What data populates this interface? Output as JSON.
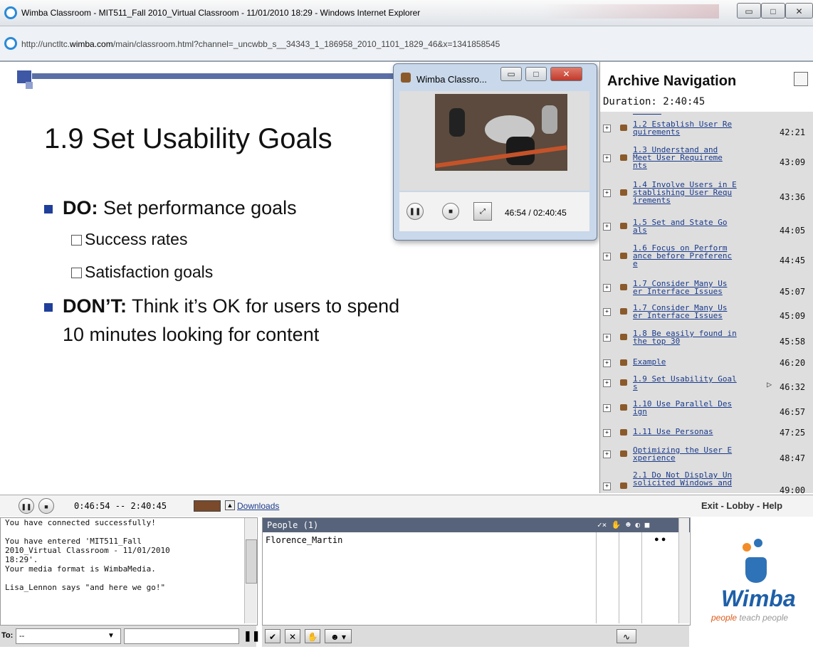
{
  "window": {
    "title": "Wimba Classroom - MIT511_Fall 2010_Virtual Classroom - 11/01/2010 18:29 - Windows Internet Explorer",
    "url_prefix": "http://unctltc.",
    "url_domain": "wimba.com",
    "url_suffix": "/main/classroom.html?channel=_uncwbb_s__34343_1_186958_2010_1101_1829_46&x=1341858545"
  },
  "slide": {
    "title": "1.9 Set Usability Goals",
    "do_label": "DO:",
    "do_text": " Set performance goals",
    "sub1": "Success rates",
    "sub2": "Satisfaction goals",
    "dont_label": "DON’T:",
    "dont_text": " Think it’s OK for users to spend",
    "dont_text2": "10 minutes looking for content"
  },
  "popup": {
    "title": "Wimba Classro...",
    "time": "46:54 / 02:40:45"
  },
  "nav": {
    "title": "Archive Navigation",
    "duration": "Duration: 2:40:45",
    "items": [
      {
        "label": "1.2 Establish User Re\nquirements",
        "time": "42:21"
      },
      {
        "label": "1.3 Understand and\nMeet User Requireme\nnts",
        "time": "43:09"
      },
      {
        "label": "1.4 Involve Users in E\nstablishing User Requ\nirements",
        "time": "43:36"
      },
      {
        "label": "1.5 Set and State Go\nals",
        "time": "44:05"
      },
      {
        "label": "1.6 Focus on Perform\nance before Preferenc\ne",
        "time": "44:45"
      },
      {
        "label": "1.7 Consider Many Us\ner Interface Issues",
        "time": "45:07"
      },
      {
        "label": "1.7 Consider Many Us\ner Interface Issues",
        "time": "45:09"
      },
      {
        "label": "1.8 Be easily found in\nthe top 30",
        "time": "45:58"
      },
      {
        "label": "Example",
        "time": "46:20"
      },
      {
        "label": "1.9 Set Usability Goal\ns",
        "time": "46:32"
      },
      {
        "label": "1.10 Use Parallel Des\nign",
        "time": "46:57"
      },
      {
        "label": "1.11 Use Personas",
        "time": "47:25"
      },
      {
        "label": "Optimizing the User E\nxperience",
        "time": "48:47"
      },
      {
        "label": "2.1 Do Not Display Un\nsolicited Windows and",
        "time": "49:00"
      }
    ]
  },
  "controls": {
    "time": "0:46:54 -- 2:40:45",
    "downloads": "Downloads",
    "exit_links": "Exit - Lobby - Help"
  },
  "chat": {
    "lines": [
      "You have connected successfully!",
      "",
      "You have entered 'MIT511_Fall",
      "2010_Virtual Classroom - 11/01/2010",
      "18:29'.",
      "Your media format is WimbaMedia.",
      "",
      "Lisa_Lennon says \"and here we go!\""
    ],
    "to_label": "To:",
    "to_value": "--"
  },
  "people": {
    "header": "People (1)",
    "member": "Florence_Martin"
  },
  "logo": {
    "brand": "Wimba",
    "tagline_people": "people",
    "tagline_rest": " teach people"
  }
}
